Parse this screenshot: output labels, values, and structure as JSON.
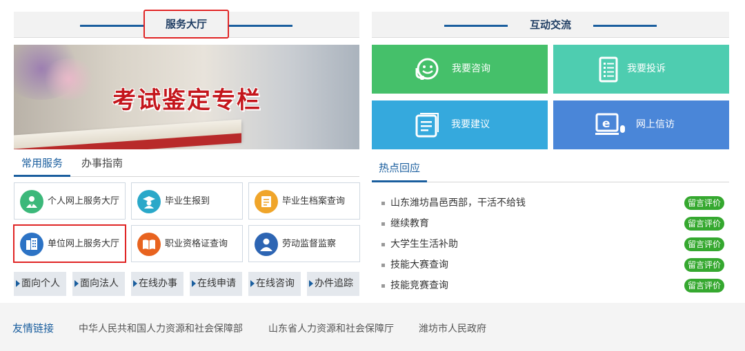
{
  "service_section": {
    "title": "服务大厅",
    "banner_text": "考试鉴定专栏",
    "tabs": [
      {
        "label": "常用服务"
      },
      {
        "label": "办事指南"
      }
    ],
    "services": [
      {
        "label": "个人网上服务大厅",
        "icon": "person-icon",
        "color": "#3cb87a"
      },
      {
        "label": "毕业生报到",
        "icon": "graduate-icon",
        "color": "#2aa8c9"
      },
      {
        "label": "毕业生档案查询",
        "icon": "folder-icon",
        "color": "#f0a52a"
      },
      {
        "label": "单位网上服务大厅",
        "icon": "building-icon",
        "color": "#2c73c5"
      },
      {
        "label": "职业资格证查询",
        "icon": "certificate-icon",
        "color": "#e8631f"
      },
      {
        "label": "劳动监督监察",
        "icon": "supervisor-icon",
        "color": "#2d65b3"
      }
    ],
    "nav_buttons": [
      {
        "label": "面向个人"
      },
      {
        "label": "面向法人"
      },
      {
        "label": "在线办事"
      },
      {
        "label": "在线申请"
      },
      {
        "label": "在线咨询"
      },
      {
        "label": "办件追踪"
      }
    ]
  },
  "interaction_section": {
    "title": "互动交流",
    "tiles": [
      {
        "label": "我要咨询",
        "icon": "chat-face-icon",
        "color": "#45c06a"
      },
      {
        "label": "我要投诉",
        "icon": "document-list-icon",
        "color": "#4ecdb0"
      },
      {
        "label": "我要建议",
        "icon": "document-icon",
        "color": "#35a9dd"
      },
      {
        "label": "网上信访",
        "icon": "computer-icon",
        "color": "#4a86d8"
      }
    ]
  },
  "hot_replies": {
    "title": "热点回应",
    "items": [
      {
        "text": "山东潍坊昌邑西部，干活不给钱",
        "badge": "留言评价"
      },
      {
        "text": "继续教育",
        "badge": "留言评价"
      },
      {
        "text": "大学生生活补助",
        "badge": "留言评价"
      },
      {
        "text": "技能大赛查询",
        "badge": "留言评价"
      },
      {
        "text": "技能竞赛查询",
        "badge": "留言评价"
      }
    ]
  },
  "friendly_links": {
    "title": "友情链接",
    "items": [
      {
        "label": "中华人民共和国人力资源和社会保障部"
      },
      {
        "label": "山东省人力资源和社会保障厅"
      },
      {
        "label": "潍坊市人民政府"
      }
    ]
  }
}
